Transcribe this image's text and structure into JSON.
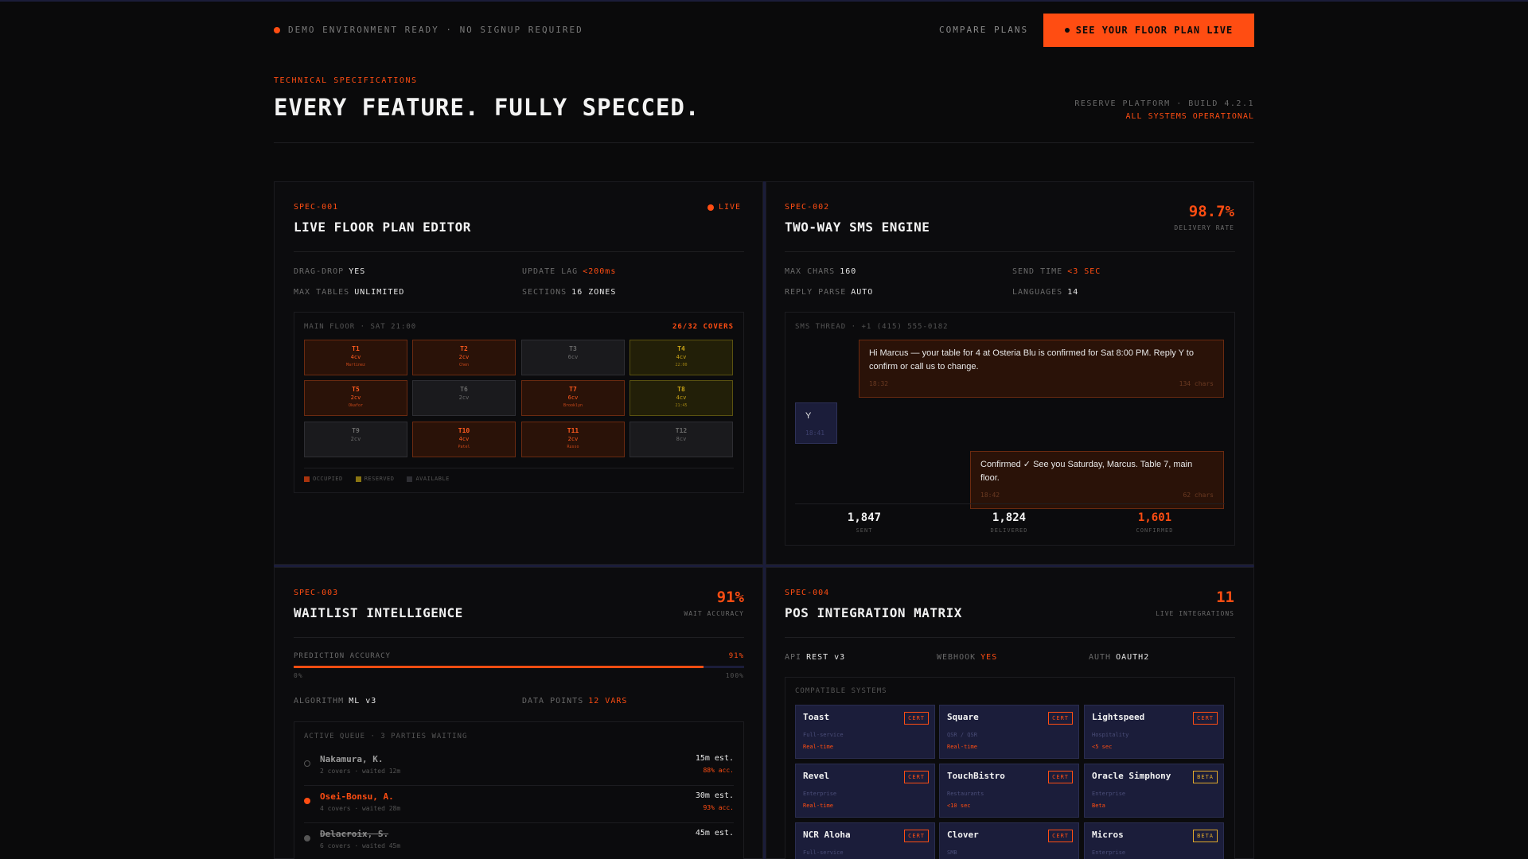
{
  "nav": {
    "status": "DEMO ENVIRONMENT READY · NO SIGNUP REQUIRED",
    "compare": "COMPARE PLANS",
    "cta": "SEE YOUR FLOOR PLAN LIVE"
  },
  "header": {
    "eyebrow": "TECHNICAL SPECIFICATIONS",
    "title": "EVERY FEATURE. FULLY SPECCED.",
    "build": "RESERVE PLATFORM · BUILD 4.2.1",
    "status": "ALL SYSTEMS OPERATIONAL"
  },
  "colors": {
    "accent": "#ff4d12",
    "navy": "#1b1d3a",
    "reserved": "#c9a417",
    "background": "#0a0a0b"
  },
  "spec1": {
    "id": "SPEC-001",
    "title": "LIVE FLOOR PLAN EDITOR",
    "live": "LIVE",
    "kv": [
      {
        "k": "DRAG-DROP",
        "v": "YES"
      },
      {
        "k": "UPDATE LAG",
        "v": "<200ms"
      },
      {
        "k": "MAX TABLES",
        "v": "UNLIMITED"
      },
      {
        "k": "SECTIONS",
        "v": "16 ZONES"
      }
    ],
    "floor_head": "MAIN FLOOR · SAT 21:00",
    "covers": "26/32 COVERS",
    "tables": [
      {
        "n": "T1",
        "c": "4cv",
        "s": "Martinez",
        "st": "occ"
      },
      {
        "n": "T2",
        "c": "2cv",
        "s": "Chen",
        "st": "occ"
      },
      {
        "n": "T3",
        "c": "6cv",
        "s": "",
        "st": "av"
      },
      {
        "n": "T4",
        "c": "4cv",
        "s": "22:00",
        "st": "res"
      },
      {
        "n": "T5",
        "c": "2cv",
        "s": "Okafor",
        "st": "occ"
      },
      {
        "n": "T6",
        "c": "2cv",
        "s": "",
        "st": "av"
      },
      {
        "n": "T7",
        "c": "6cv",
        "s": "Brooklyn",
        "st": "occ"
      },
      {
        "n": "T8",
        "c": "4cv",
        "s": "21:45",
        "st": "res"
      },
      {
        "n": "T9",
        "c": "2cv",
        "s": "",
        "st": "av"
      },
      {
        "n": "T10",
        "c": "4cv",
        "s": "Patel",
        "st": "occ"
      },
      {
        "n": "T11",
        "c": "2cv",
        "s": "Russo",
        "st": "occ"
      },
      {
        "n": "T12",
        "c": "8cv",
        "s": "",
        "st": "av"
      }
    ],
    "legend": [
      "OCCUPIED",
      "RESERVED",
      "AVAILABLE"
    ]
  },
  "spec2": {
    "id": "SPEC-002",
    "title": "TWO-WAY SMS ENGINE",
    "metric": "98.7%",
    "metric_label": "DELIVERY RATE",
    "kv": [
      {
        "k": "MAX CHARS",
        "v": "160"
      },
      {
        "k": "SEND TIME",
        "v": "<3 SEC"
      },
      {
        "k": "REPLY PARSE",
        "v": "AUTO"
      },
      {
        "k": "LANGUAGES",
        "v": "14"
      }
    ],
    "thread_head": "SMS THREAD · +1 (415) 555-0182",
    "msg1": "Hi Marcus — your table for 4 at Osteria Blu is confirmed for Sat 8:00 PM. Reply Y to confirm or call us to change.",
    "msg1_time": "18:32",
    "msg1_chars": "134 chars",
    "reply": "Y",
    "reply_time": "18:41",
    "msg2": "Confirmed ✓ See you Saturday, Marcus. Table 7, main floor.",
    "msg2_time": "18:42",
    "msg2_chars": "62 chars",
    "stats": [
      {
        "n": "1,847",
        "l": "SENT"
      },
      {
        "n": "1,824",
        "l": "DELIVERED"
      },
      {
        "n": "1,601",
        "l": "CONFIRMED"
      }
    ]
  },
  "spec3": {
    "id": "SPEC-003",
    "title": "WAITLIST INTELLIGENCE",
    "metric": "91%",
    "metric_label": "WAIT ACCURACY",
    "bar_label": "PREDICTION ACCURACY",
    "bar_value": "91%",
    "bar_fraction": 0.91,
    "bar_min": "0%",
    "bar_max": "100%",
    "kv": [
      {
        "k": "ALGORITHM",
        "v": "ML v3"
      },
      {
        "k": "DATA POINTS",
        "v": "12 VARS"
      }
    ],
    "queue_head": "ACTIVE QUEUE · 3 PARTIES WAITING",
    "queue": [
      {
        "name": "Nakamura, K.",
        "sub": "2 covers · waited 12m",
        "est": "15m est.",
        "acc": "88% acc."
      },
      {
        "name": "Osei-Bonsu, A.",
        "sub": "4 covers · waited 28m",
        "est": "30m est.",
        "acc": "93% acc."
      },
      {
        "name": "Delacroix, S.",
        "sub": "6 covers · waited 45m",
        "est": "45m est.",
        "acc": ""
      }
    ]
  },
  "spec4": {
    "id": "SPEC-004",
    "title": "POS INTEGRATION MATRIX",
    "metric": "11",
    "metric_label": "LIVE INTEGRATIONS",
    "kv": [
      {
        "k": "API",
        "v": "REST v3"
      },
      {
        "k": "WEBHOOK",
        "v": "YES"
      },
      {
        "k": "AUTH",
        "v": "OAUTH2"
      }
    ],
    "compat_head": "COMPATIBLE SYSTEMS",
    "systems": [
      {
        "name": "Toast",
        "badge": "CERT",
        "type": "Full-service",
        "sync": "Real-time"
      },
      {
        "name": "Square",
        "badge": "CERT",
        "type": "QSR / QSR",
        "sync": "Real-time"
      },
      {
        "name": "Lightspeed",
        "badge": "CERT",
        "type": "Hospitality",
        "sync": "<5 sec"
      },
      {
        "name": "Revel",
        "badge": "CERT",
        "type": "Enterprise",
        "sync": "Real-time"
      },
      {
        "name": "TouchBistro",
        "badge": "CERT",
        "type": "Restaurants",
        "sync": "<10 sec"
      },
      {
        "name": "Oracle Simphony",
        "badge": "BETA",
        "type": "Enterprise",
        "sync": "Beta"
      },
      {
        "name": "NCR Aloha",
        "badge": "CERT",
        "type": "Full-service",
        "sync": ""
      },
      {
        "name": "Clover",
        "badge": "CERT",
        "type": "SMB",
        "sync": ""
      },
      {
        "name": "Micros",
        "badge": "BETA",
        "type": "Enterprise",
        "sync": ""
      }
    ]
  }
}
